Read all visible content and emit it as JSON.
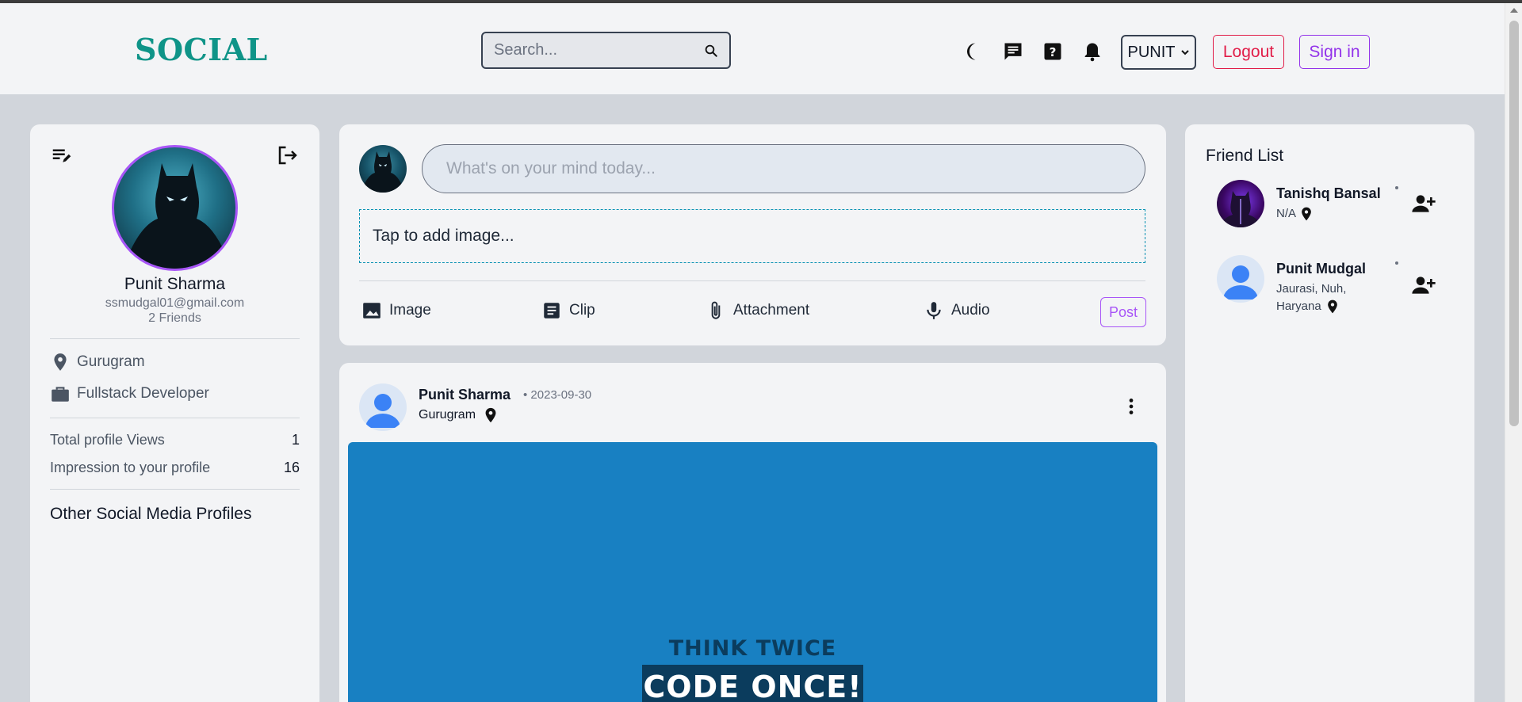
{
  "app": {
    "logo": "SOCIAL"
  },
  "header": {
    "search_placeholder": "Search...",
    "icons": [
      "moon-icon",
      "chat-icon",
      "help-icon",
      "bell-icon",
      "search-icon"
    ],
    "user_select_value": "PUNIT",
    "logout_label": "Logout",
    "signin_label": "Sign in"
  },
  "profile": {
    "name": "Punit Sharma",
    "email": "ssmudgal01@gmail.com",
    "friends": "2 Friends",
    "location": "Gurugram",
    "occupation": "Fullstack Developer",
    "stats": [
      {
        "label": "Total profile Views",
        "value": "1"
      },
      {
        "label": "Impression to your profile",
        "value": "16"
      }
    ],
    "social_title": "Other Social Media Profiles"
  },
  "composer": {
    "placeholder": "What's on your mind today...",
    "image_drop": "Tap to add image...",
    "actions": [
      "Image",
      "Clip",
      "Attachment",
      "Audio"
    ],
    "post_label": "Post"
  },
  "post": {
    "author": "Punit Sharma",
    "date": "• 2023-09-30",
    "location": "Gurugram",
    "image_text_top": "THINK TWICE",
    "image_text_bottom": "CODE ONCE!"
  },
  "friend_list": {
    "title": "Friend List",
    "friends": [
      {
        "name": "Tanishq Bansal",
        "location": "N/A"
      },
      {
        "name": "Punit Mudgal",
        "location": "Jaurasi, Nuh, Haryana"
      }
    ]
  },
  "colors": {
    "brand": "#0f9488",
    "logout": "#e11d48",
    "signin": "#9333ea",
    "post_image_bg": "#1880c2"
  }
}
